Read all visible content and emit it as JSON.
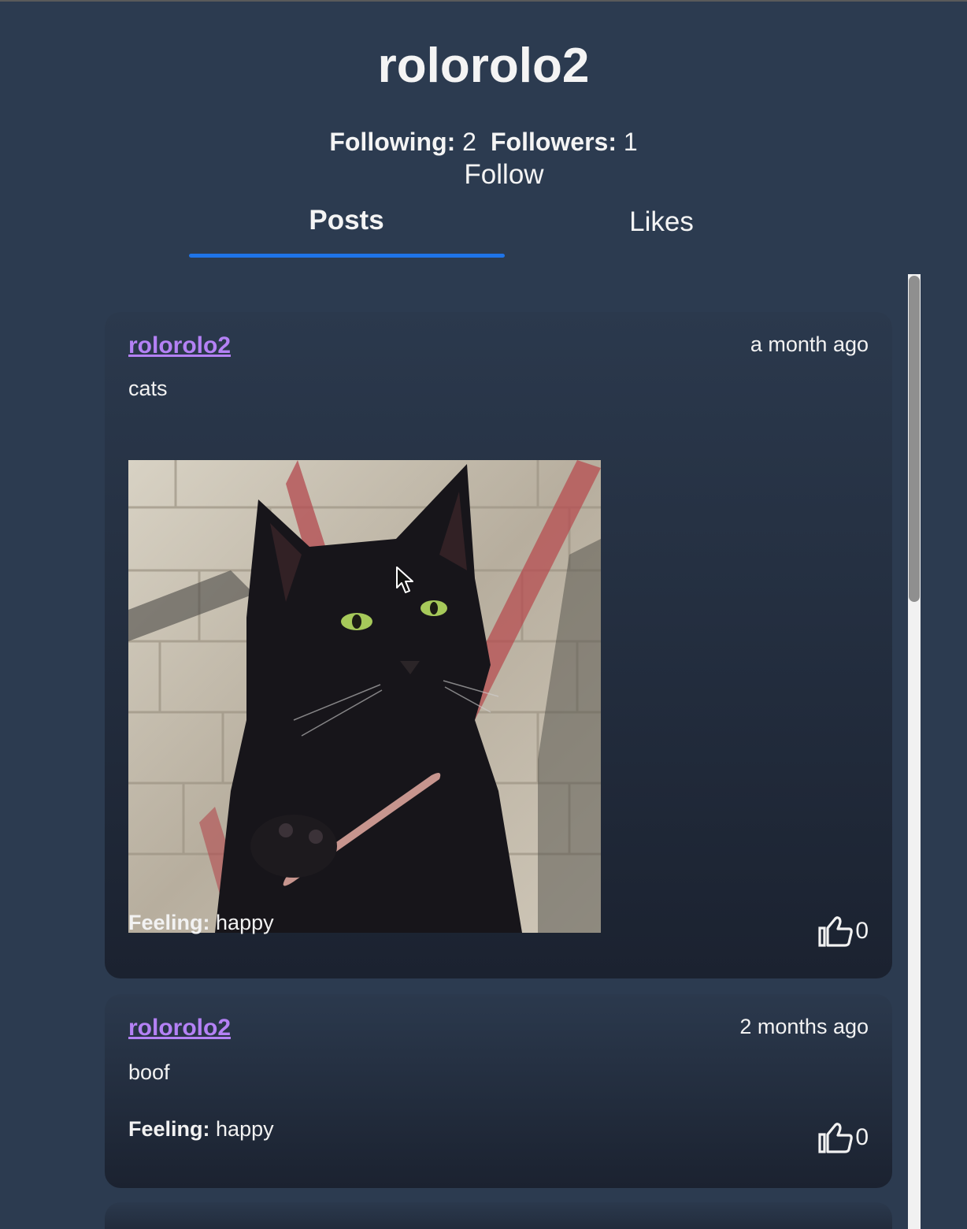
{
  "profile": {
    "username": "rolorolo2",
    "following_label": "Following:",
    "following_count": "2",
    "followers_label": "Followers:",
    "followers_count": "1",
    "follow_button": "Follow"
  },
  "tabs": [
    {
      "label": "Posts",
      "active": true
    },
    {
      "label": "Likes",
      "active": false
    }
  ],
  "posts": [
    {
      "author": "rolorolo2",
      "time": "a month ago",
      "text": "cats",
      "has_image": true,
      "image_subject": "black cat holding a nail file",
      "feeling_label": "Feeling:",
      "feeling": "happy",
      "likes": "0"
    },
    {
      "author": "rolorolo2",
      "time": "2 months ago",
      "text": "boof",
      "has_image": false,
      "feeling_label": "Feeling:",
      "feeling": "happy",
      "likes": "0"
    }
  ],
  "icons": {
    "like": "thumbs-up-icon",
    "cursor": "mouse-pointer-icon"
  },
  "colors": {
    "background": "#2c3b50",
    "username_link": "#b481f5",
    "tab_indicator": "#1f74e8"
  }
}
